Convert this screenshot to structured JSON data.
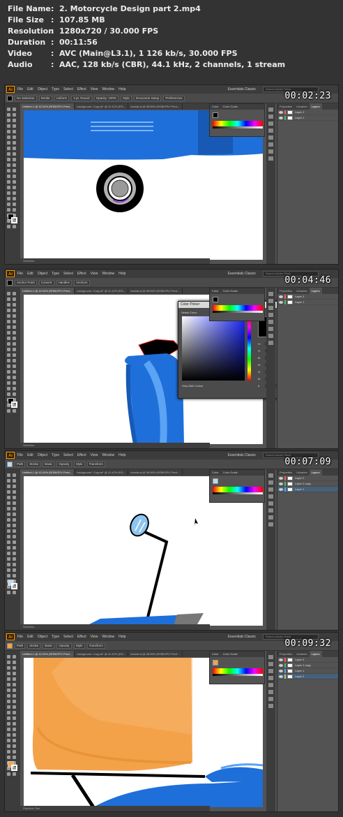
{
  "info": {
    "rows": [
      {
        "key": "File Name",
        "sep": ":",
        "value": "2. Motorcycle Design part 2.mp4"
      },
      {
        "key": "File Size",
        "sep": ":",
        "value": "107.85 MB"
      },
      {
        "key": "Resolution",
        "sep": ":",
        "value": "1280x720 / 30.000 FPS"
      },
      {
        "key": "Duration",
        "sep": ":",
        "value": "00:11:56"
      },
      {
        "key": "Video",
        "sep": ":",
        "value": "AVC (Main@L3.1), 1 126 kb/s, 30.000 FPS"
      },
      {
        "key": "Audio",
        "sep": ":",
        "value": "AAC, 128 kb/s (CBR), 44.1 kHz, 2 channels, 1 stream"
      }
    ]
  },
  "app": {
    "logo": "Ai",
    "menu": [
      "File",
      "Edit",
      "Object",
      "Type",
      "Select",
      "Effect",
      "View",
      "Window",
      "Help"
    ],
    "workspace": "Essentials Classic",
    "search_placeholder": "Search Adobe Stock",
    "tabs": [
      "Untitled-1 @ 42.04% (RGB/GPU Previ...",
      "background -Copy.ai* @ 41.42% (RG...",
      "tutorial.ai @ 58.56% (RGB/GPU Previ..."
    ],
    "color_panel_tabs": [
      "Color",
      "Color Guide"
    ],
    "panel_tabs": [
      "Properties",
      "Libraries",
      "Layers"
    ]
  },
  "frames": [
    {
      "timestamp": "00:02:23",
      "ctrl": [
        "No Selection",
        "Stroke",
        "Uniform",
        "3 pt. Round",
        "Opacity: 100%",
        "Style",
        "Document Setup",
        "Preferences"
      ],
      "layers": [
        "Layer 2",
        "Layer 1"
      ],
      "status": "Selection",
      "fill_color": "#000000"
    },
    {
      "timestamp": "00:04:46",
      "ctrl": [
        "Anchor Point",
        "Convert",
        "Handles",
        "Anchors"
      ],
      "layers": [
        "Layer 2",
        "Layer 1"
      ],
      "status": "Selection",
      "fill_color": "#000000"
    },
    {
      "timestamp": "00:07:09",
      "ctrl": [
        "Path",
        "Stroke",
        "Basic",
        "Opacity",
        "Style",
        "Transform"
      ],
      "layers": [
        "Layer 2",
        "Layer 2 copy",
        "Layer 1"
      ],
      "status": "Selection",
      "fill_color": "#bcd9ef"
    },
    {
      "timestamp": "00:09:32",
      "ctrl": [
        "Path",
        "Stroke",
        "Basic",
        "Opacity",
        "Style",
        "Transform"
      ],
      "layers": [
        "Layer 3",
        "Layer 2 copy",
        "Layer 1",
        "Layer 2"
      ],
      "status": "Direction Tool",
      "fill_color": "#f4a24a"
    }
  ],
  "color_picker": {
    "title": "Color Picker",
    "select_label": "Select Color:",
    "ok": "OK",
    "cancel": "Cancel",
    "swatches": "Color Swatches",
    "only_web": "Only Web Colors",
    "fields": [
      {
        "label": "H:",
        "value": "240°"
      },
      {
        "label": "S:",
        "value": "5%"
      },
      {
        "label": "B:",
        "value": "0%"
      },
      {
        "label": "R:",
        "value": "0"
      },
      {
        "label": "G:",
        "value": "0"
      },
      {
        "label": "B:",
        "value": "0"
      },
      {
        "label": "#",
        "value": "000000"
      }
    ],
    "cmyk": [
      {
        "label": "C:",
        "value": "75%"
      },
      {
        "label": "M:",
        "value": "68%"
      },
      {
        "label": "Y:",
        "value": "67%"
      },
      {
        "label": "K:",
        "value": "90%"
      }
    ]
  },
  "colors": {
    "blue": "#1e6fd9",
    "orange": "#f4a24a",
    "canvas": "#ffffff",
    "panel_bg": "#535353"
  }
}
